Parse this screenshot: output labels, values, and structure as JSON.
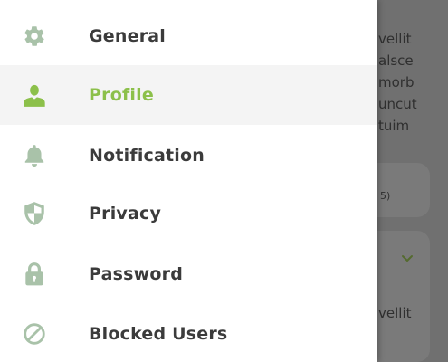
{
  "background": {
    "text_lines": [
      "vellit",
      "alsce",
      "morb",
      "uncut",
      "tuim"
    ],
    "small_text": "5)",
    "text_line_2": "vellit"
  },
  "menu": {
    "items": [
      {
        "label": "General",
        "icon": "gear-icon",
        "active": false
      },
      {
        "label": "Profile",
        "icon": "person-icon",
        "active": true
      },
      {
        "label": "Notification",
        "icon": "bell-icon",
        "active": false
      },
      {
        "label": "Privacy",
        "icon": "shield-icon",
        "active": false
      },
      {
        "label": "Password",
        "icon": "lock-icon",
        "active": false
      },
      {
        "label": "Blocked Users",
        "icon": "blocked-icon",
        "active": false
      }
    ]
  },
  "colors": {
    "accent": "#8cc04a",
    "icon_muted": "#a9c2a9",
    "text": "#3b3b3b",
    "active_bg": "#f4f4f4",
    "scrim": "#707070"
  }
}
